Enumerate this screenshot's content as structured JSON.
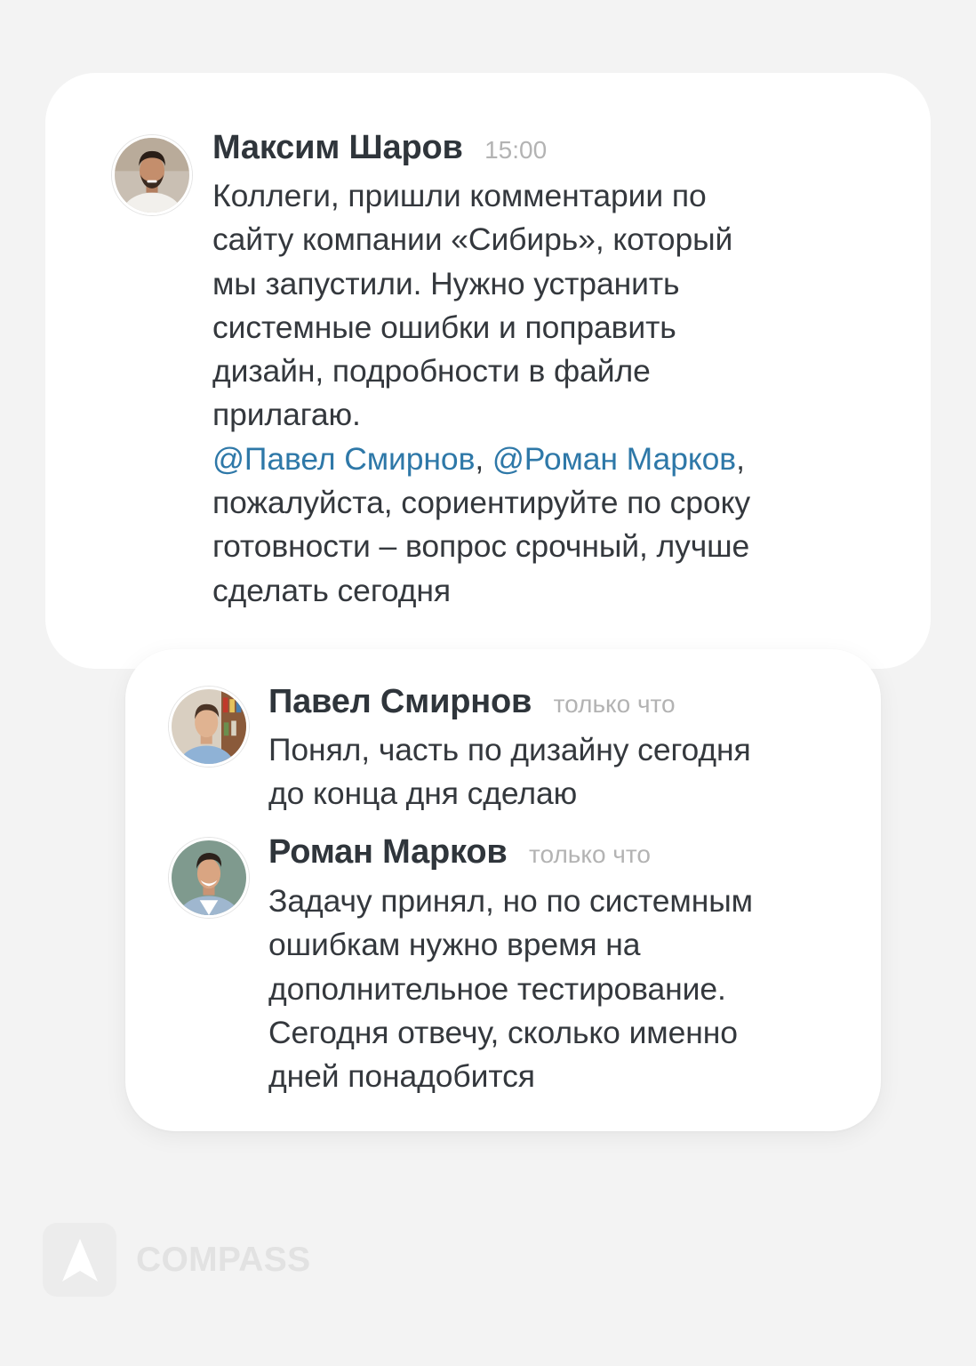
{
  "main_message": {
    "author": "Максим Шаров",
    "time": "15:00",
    "lines": [
      "Коллеги, пришли комментарии по",
      "сайту компании «Сибирь», который",
      "мы запустили. Нужно устранить",
      "системные ошибки и поправить",
      "дизайн, подробности в файле",
      "прилагаю."
    ],
    "mention_1": "@Павел Смирнов",
    "mention_sep": ", ",
    "mention_2": "@Роман Марков",
    "mention_end": ",",
    "after_lines": [
      "пожалуйста, сориентируйте по сроку",
      "готовности – вопрос срочный, лучше",
      "сделать сегодня"
    ]
  },
  "replies": [
    {
      "author": "Павел Смирнов",
      "time": "только что",
      "lines": [
        "Понял, часть по дизайну сегодня",
        "до конца дня сделаю"
      ]
    },
    {
      "author": "Роман Марков",
      "time": "только что",
      "lines": [
        "Задачу принял, но по системным",
        "ошибкам нужно время на",
        "дополнительное тестирование.",
        "Сегодня отвечу, сколько именно",
        "дней понадобится"
      ]
    }
  ],
  "brand": {
    "name": "COMPASS",
    "icon": "compass-arrow-icon"
  },
  "colors": {
    "mention": "#2e78a8",
    "background": "#f3f3f3",
    "card": "#ffffff"
  }
}
